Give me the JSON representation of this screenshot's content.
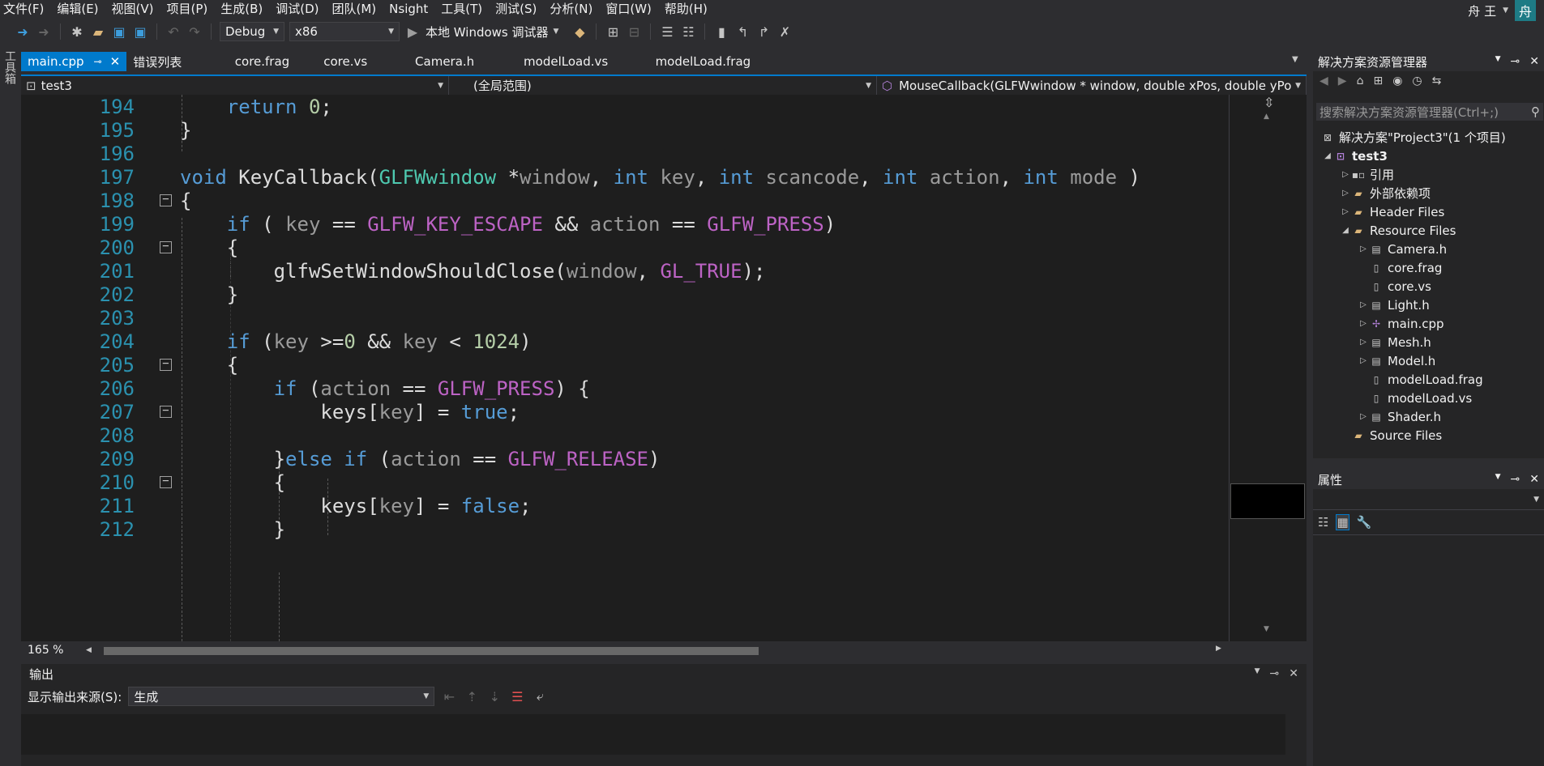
{
  "menu": [
    "文件(F)",
    "编辑(E)",
    "视图(V)",
    "项目(P)",
    "生成(B)",
    "调试(D)",
    "团队(M)",
    "Nsight",
    "工具(T)",
    "测试(S)",
    "分析(N)",
    "窗口(W)",
    "帮助(H)"
  ],
  "user": {
    "name": "舟 王",
    "avatar_text": "舟"
  },
  "toolbar": {
    "config": "Debug",
    "platform": "x86",
    "run_label": "本地 Windows 调试器"
  },
  "toolbox_label": "工具箱",
  "tabs": [
    {
      "label": "main.cpp",
      "active": true
    },
    {
      "label": "错误列表"
    },
    {
      "label": "core.frag"
    },
    {
      "label": "core.vs"
    },
    {
      "label": "Camera.h"
    },
    {
      "label": "modelLoad.vs"
    },
    {
      "label": "modelLoad.frag"
    }
  ],
  "navbar": {
    "project": "test3",
    "scope": "(全局范围)",
    "member": "MouseCallback(GLFWwindow * window, double xPos, double yPos)"
  },
  "code_lines": [
    {
      "n": "194"
    },
    {
      "n": "195"
    },
    {
      "n": "196"
    },
    {
      "n": "197"
    },
    {
      "n": "198"
    },
    {
      "n": "199"
    },
    {
      "n": "200"
    },
    {
      "n": "201"
    },
    {
      "n": "202"
    },
    {
      "n": "203"
    },
    {
      "n": "204"
    },
    {
      "n": "205"
    },
    {
      "n": "206"
    },
    {
      "n": "207"
    },
    {
      "n": "208"
    },
    {
      "n": "209"
    },
    {
      "n": "210"
    },
    {
      "n": "211"
    },
    {
      "n": "212"
    }
  ],
  "editor": {
    "zoom": "165 %"
  },
  "solution_explorer": {
    "title": "解决方案资源管理器",
    "search_placeholder": "搜索解决方案资源管理器(Ctrl+;)",
    "items": [
      {
        "label": "解决方案\"Project3\"(1 个项目)"
      },
      {
        "label": "test3"
      },
      {
        "label": "引用"
      },
      {
        "label": "外部依赖项"
      },
      {
        "label": "Header Files"
      },
      {
        "label": "Resource Files"
      },
      {
        "label": "Camera.h"
      },
      {
        "label": "core.frag"
      },
      {
        "label": "core.vs"
      },
      {
        "label": "Light.h"
      },
      {
        "label": "main.cpp"
      },
      {
        "label": "Mesh.h"
      },
      {
        "label": "Model.h"
      },
      {
        "label": "modelLoad.frag"
      },
      {
        "label": "modelLoad.vs"
      },
      {
        "label": "Shader.h"
      },
      {
        "label": "Source Files"
      }
    ]
  },
  "properties": {
    "title": "属性"
  },
  "output": {
    "title": "输出",
    "source_label": "显示输出来源(S):",
    "source_value": "生成"
  }
}
